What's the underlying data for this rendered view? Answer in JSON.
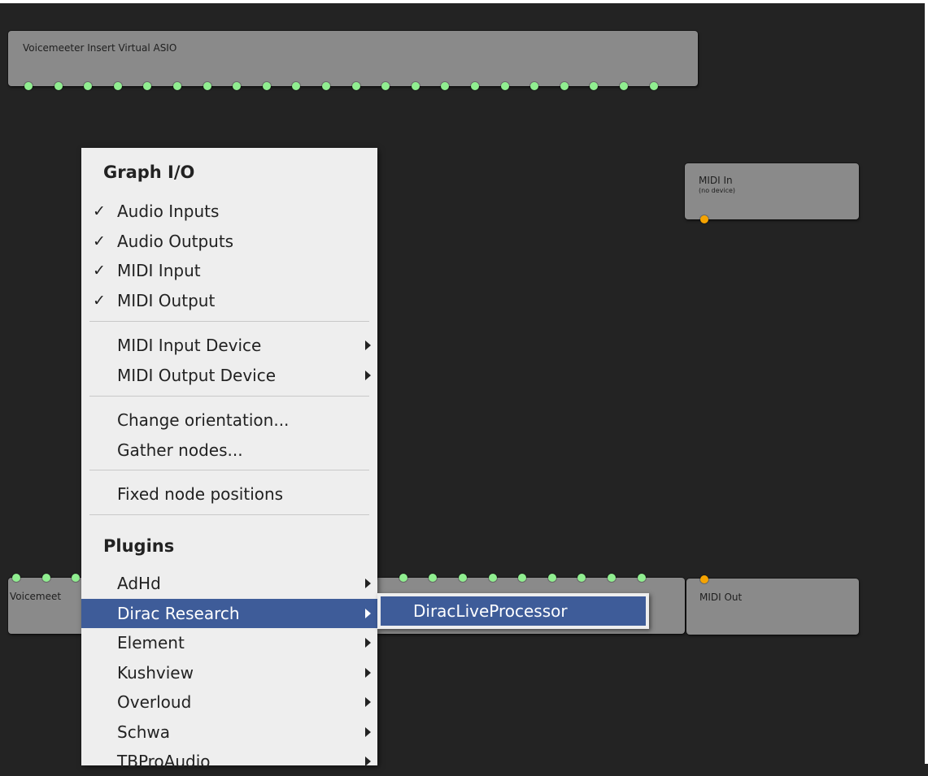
{
  "nodes": {
    "top_asio": {
      "title": "Voicemeeter Insert Virtual ASIO",
      "port_count": 22
    },
    "midi_in": {
      "title": "MIDI In",
      "subtitle": "(no device)"
    },
    "bottom_asio": {
      "title": "Voicemeet",
      "port_count": 22
    },
    "midi_out": {
      "title": "MIDI Out"
    }
  },
  "context_menu": {
    "graph_io_header": "Graph I/O",
    "check_mark": "✓",
    "items": {
      "audio_inputs": "Audio Inputs",
      "audio_outputs": "Audio Outputs",
      "midi_input": "MIDI Input",
      "midi_output": "MIDI Output",
      "midi_input_device": "MIDI Input Device",
      "midi_output_device": "MIDI Output Device",
      "change_orientation": "Change orientation...",
      "gather_nodes": "Gather nodes...",
      "fixed_node_positions": "Fixed node positions"
    },
    "plugins_header": "Plugins",
    "plugins": [
      "AdHd",
      "Dirac Research",
      "Element",
      "Kushview",
      "Overloud",
      "Schwa",
      "TBProAudio"
    ],
    "highlighted_plugin": "Dirac Research"
  },
  "submenu": {
    "items": [
      "DiracLiveProcessor"
    ]
  },
  "colors": {
    "canvas": "#232323",
    "node": "#8a8a8a",
    "audio_port": "#90ee90",
    "midi_port": "#f5a300",
    "menu_bg": "#eeeeee",
    "highlight": "#3e5c99"
  }
}
